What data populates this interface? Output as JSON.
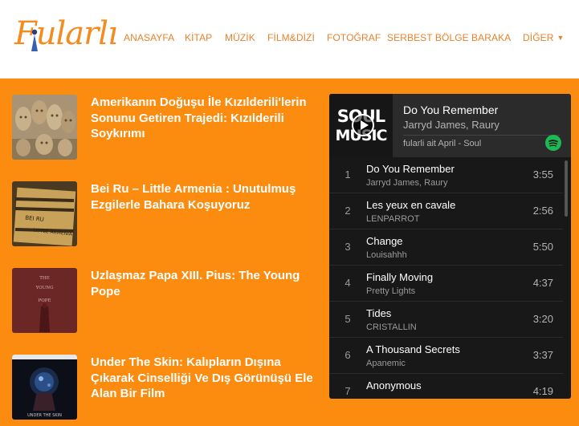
{
  "logo": {
    "text": "Fularlı"
  },
  "nav": {
    "items": [
      "ANASAYFA",
      "KİTAP",
      "MÜZİK",
      "FİLM&DİZİ",
      "FOTOĞRAF",
      "SERBEST BÖLGE",
      "BARAKA",
      "DİĞER"
    ],
    "more_caret": "▼"
  },
  "articles": [
    {
      "title": "Amerikanın Doğuşu İle Kızılderili'lerin Sonunu Getiren Trajedi: Kızılderili Soykırımı"
    },
    {
      "title": "Bei Ru – Little Armenia : Unutulmuş Ezgilerle Bahara Koşuyoruz",
      "thumb_text": "BEI RU LITTLE ARMENIA"
    },
    {
      "title": "Uzlaşmaz Papa XIII. Pius: The Young Pope",
      "thumb_text": "THE YOUNG POPE"
    },
    {
      "title": "Under The Skin: Kalıpların Dışına Çıkarak Cinselliği Ve Dış Görünüşü Ele Alan Bir Film",
      "thumb_text": "UNDER THE SKIN"
    }
  ],
  "player": {
    "cover_text": "SOUL MUSIC",
    "now_title": "Do You Remember",
    "now_artist": "Jarryd James, Raury",
    "playlist": "fularli ait April - Soul",
    "tracks": [
      {
        "num": "1",
        "name": "Do You Remember",
        "artist": "Jarryd James, Raury",
        "duration": "3:55"
      },
      {
        "num": "2",
        "name": "Les yeux en cavale",
        "artist": "LENPARROT",
        "duration": "2:56"
      },
      {
        "num": "3",
        "name": "Change",
        "artist": "Louisahhh",
        "duration": "5:50"
      },
      {
        "num": "4",
        "name": "Finally Moving",
        "artist": "Pretty Lights",
        "duration": "4:37"
      },
      {
        "num": "5",
        "name": "Tides",
        "artist": "CRISTALLIN",
        "duration": "3:20"
      },
      {
        "num": "6",
        "name": "A Thousand Secrets",
        "artist": "Apanemic",
        "duration": "3:37"
      },
      {
        "num": "7",
        "name": "Anonymous",
        "artist": "",
        "duration": "4:19"
      }
    ]
  },
  "colors": {
    "accent": "#fb8c0f",
    "nav_text": "#e8822c",
    "player_bg": "#181818",
    "spotify_green": "#1db954"
  }
}
